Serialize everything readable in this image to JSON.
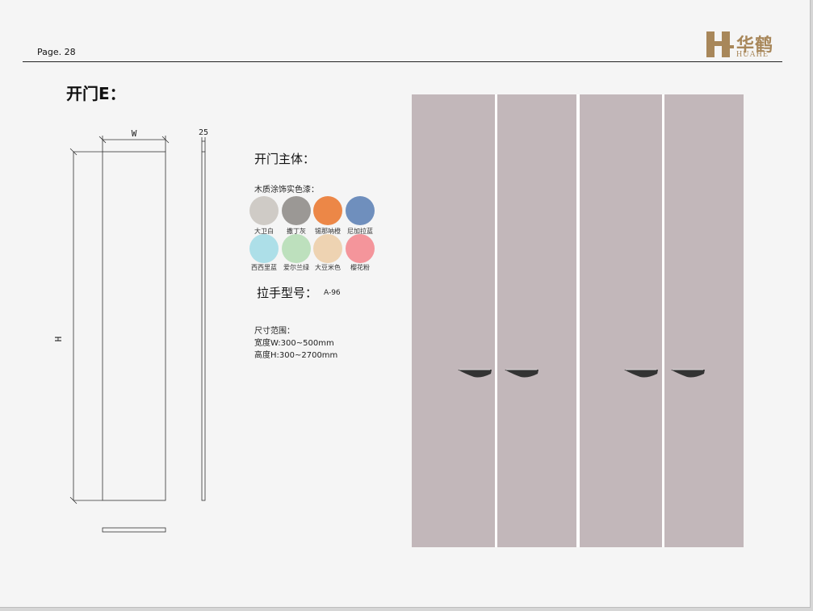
{
  "header": {
    "page_label": "Page. 28",
    "logo_cn": "华鹤",
    "logo_en": "HUAHE"
  },
  "title": "开门E：",
  "drawing": {
    "width_label": "W",
    "height_label": "H",
    "thickness_label": "25"
  },
  "main_body": {
    "title": "开门主体：",
    "finish_label": "木质涂饰实色漆：",
    "colors": [
      {
        "name": "大卫白",
        "hex": "#cfcbc6"
      },
      {
        "name": "撒丁灰",
        "hex": "#9b9895"
      },
      {
        "name": "锡那呐橙",
        "hex": "#ec8747"
      },
      {
        "name": "尼加拉蓝",
        "hex": "#6f8fbd"
      },
      {
        "name": "西西里蓝",
        "hex": "#addfe8"
      },
      {
        "name": "爱尔兰绿",
        "hex": "#bde0bd"
      },
      {
        "name": "大豆米色",
        "hex": "#eed3b2"
      },
      {
        "name": "樱花粉",
        "hex": "#f4959b"
      }
    ]
  },
  "handle": {
    "label": "拉手型号：",
    "model": "A-96"
  },
  "size_range": {
    "label": "尺寸范围：",
    "width": "宽度W:300~500mm",
    "height": "高度H:300~2700mm"
  },
  "photo": {
    "door_color": "#c2b7ba"
  }
}
